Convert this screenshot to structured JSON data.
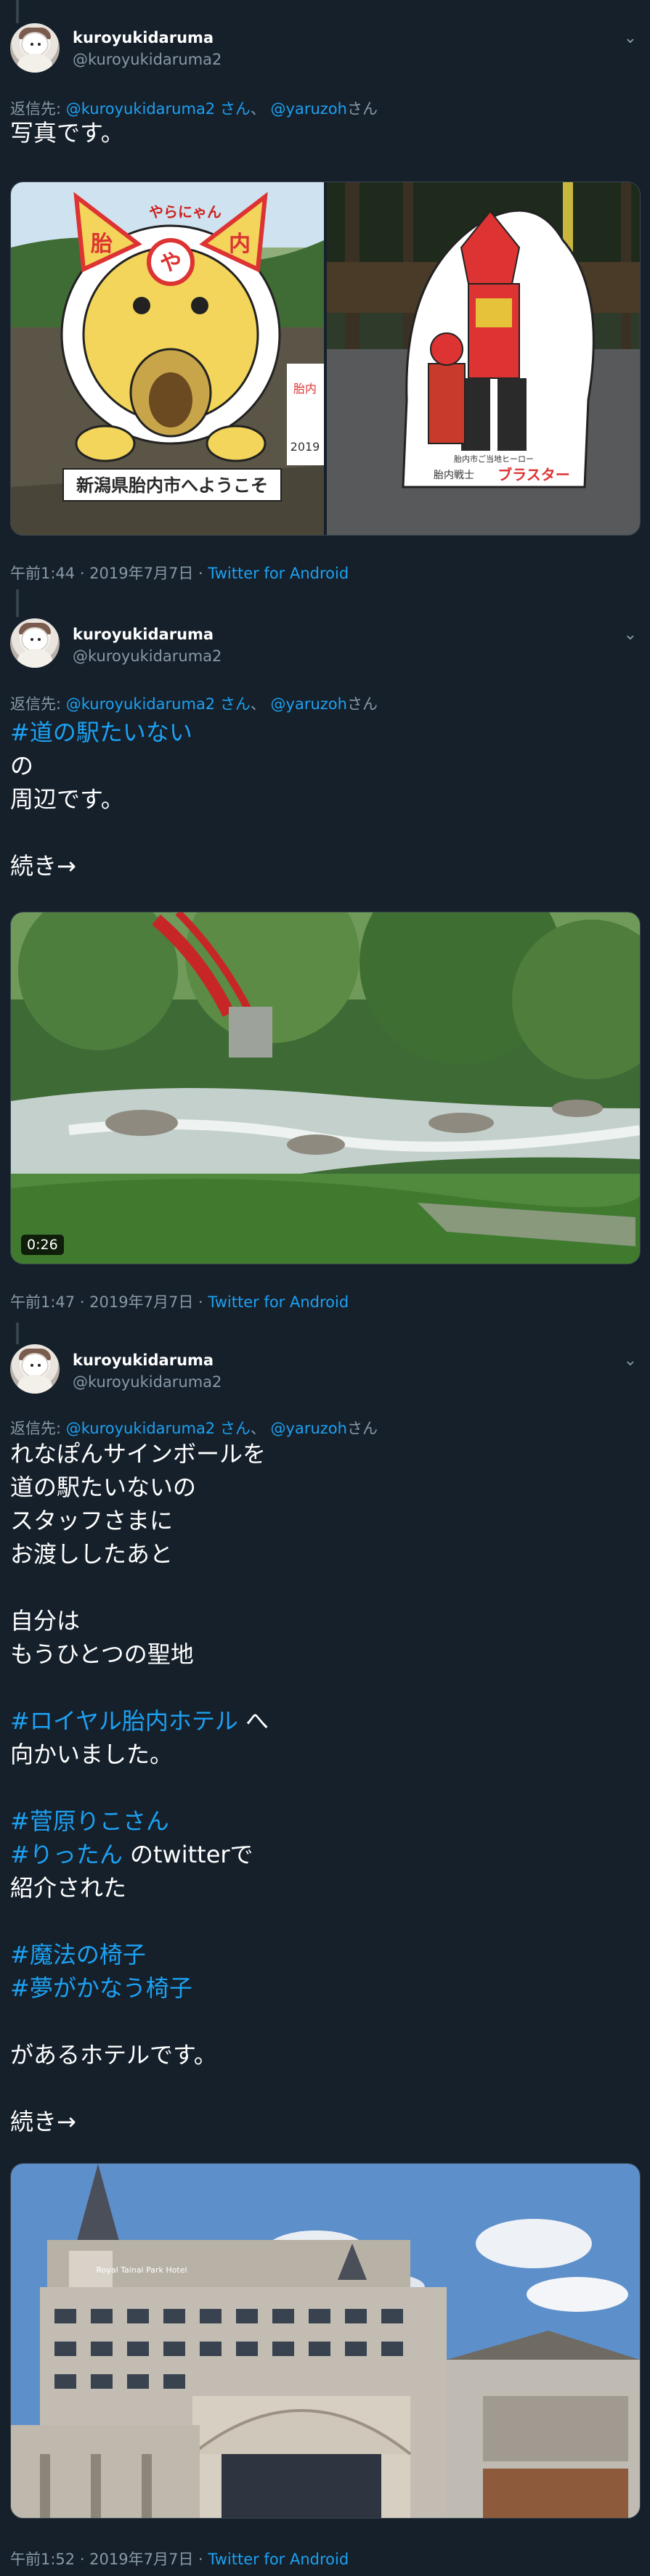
{
  "tweets": [
    {
      "name": "kuroyukidaruma",
      "handle": "@kuroyukidaruma2",
      "replying_prefix": "返信先:",
      "replying_user1": "@kuroyukidaruma2 さん",
      "replying_sep": "、",
      "replying_user2": "@yaruzoh",
      "replying_suffix": "さん",
      "lines": [
        "写真です。"
      ],
      "time": "午前1:44 · 2019年7月7日 · ",
      "source": "Twitter for Android",
      "photo_texts": {
        "sign_left_top": "やらにゃん",
        "sign_left_kanji1": "胎",
        "sign_left_kanji2": "内",
        "sign_left_face": "や",
        "sign_left_bottom": "新潟県胎内市へようこそ",
        "sign_left_side": "2019",
        "sign_left_side2": "胎内",
        "sign_right_caption1": "胎内市ご当地ヒーロー",
        "sign_right_caption2": "胎内戦士",
        "sign_right_name": "ブラスター"
      }
    },
    {
      "name": "kuroyukidaruma",
      "handle": "@kuroyukidaruma2",
      "replying_prefix": "返信先:",
      "replying_user1": "@kuroyukidaruma2 さん",
      "replying_sep": "、",
      "replying_user2": "@yaruzoh",
      "replying_suffix": "さん",
      "hashtag": "#道の駅たいない",
      "lines": [
        "の",
        "周辺です。",
        "",
        "続き→"
      ],
      "video_duration": "0:26",
      "time": "午前1:47 · 2019年7月7日 · ",
      "source": "Twitter for Android"
    },
    {
      "name": "kuroyukidaruma",
      "handle": "@kuroyukidaruma2",
      "replying_prefix": "返信先:",
      "replying_user1": "@kuroyukidaruma2 さん",
      "replying_sep": "、",
      "replying_user2": "@yaruzoh",
      "replying_suffix": "さん",
      "lines_a": [
        "れなぽんサインボールを",
        "道の駅たいないの",
        "スタッフさまに",
        "お渡ししたあと",
        "",
        "自分は",
        "もうひとつの聖地"
      ],
      "hashtag_hotel": "#ロイヤル胎内ホテル",
      "hotel_suffix": " へ",
      "line_went": "向かいました。",
      "hashtag_riko": "#菅原りこさん",
      "hashtag_rittan": "#りったん",
      "rittan_suffix": " のtwitterで",
      "line_introduced": "紹介された",
      "hashtag_chair1": "#魔法の椅子",
      "hashtag_chair2": "#夢がかなう椅子",
      "line_hotel": "があるホテルです。",
      "line_cont": "続き→",
      "hotel_sign": "Royal Tainai Park Hotel",
      "time": "午前1:52 · 2019年7月7日 · ",
      "source": "Twitter for Android"
    }
  ],
  "colors": {
    "bg": "#15202b",
    "link": "#1da1f2",
    "muted": "#8899a6",
    "border": "#38444d"
  }
}
